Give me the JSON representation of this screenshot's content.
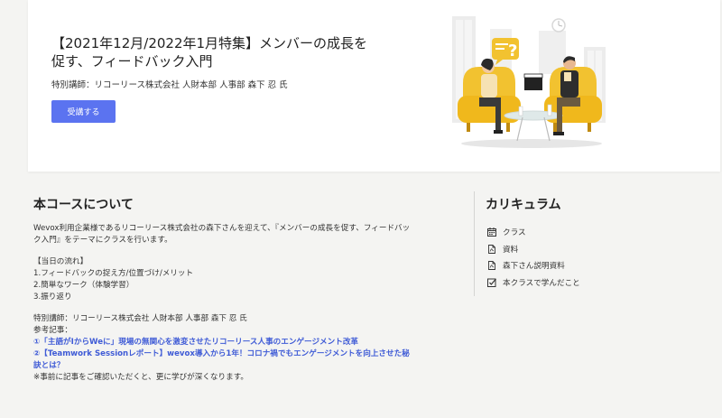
{
  "hero": {
    "title": "【2021年12月/2022年1月特集】メンバーの成長を促す、フィードバック入門",
    "instructor": "特別講師：リコーリース株式会社 人財本部 人事部 森下 忍 氏",
    "enroll_label": "受講する",
    "illustration_question_mark": "?"
  },
  "about": {
    "heading": "本コースについて",
    "intro": "Wevox利用企業様であるリコーリース株式会社の森下さんを迎えて、『メンバーの成長を促す、フィードバック入門』をテーマにクラスを行います。",
    "flow_heading": "【当日の流れ】",
    "flow_items": [
      "1.フィードバックの捉え方/位置づけ/メリット",
      "2.簡単なワーク（体験学習）",
      "3.振り返り"
    ],
    "instructor": "特別講師：リコーリース株式会社 人財本部 人事部 森下 忍 氏",
    "refs_heading": "参考記事：",
    "ref_links": [
      "①「主語がIからWeに」現場の無関心を激変させたリコーリース人事のエンゲージメント改革",
      "②【Teamwork Sessionレポート】wevox導入から1年！コロナ禍でもエンゲージメントを向上させた秘訣とは？"
    ],
    "note": "※事前に記事をご確認いただくと、更に学びが深くなります。"
  },
  "curriculum": {
    "heading": "カリキュラム",
    "items": [
      {
        "label": "クラス",
        "icon": "calendar-icon"
      },
      {
        "label": "資料",
        "icon": "pdf-file-icon"
      },
      {
        "label": "森下さん説明資料",
        "icon": "pdf-file-icon"
      },
      {
        "label": "本クラスで学んだこと",
        "icon": "checkbox-icon"
      }
    ]
  },
  "colors": {
    "accent": "#5b73f0",
    "link": "#3f5bd6",
    "background": "#f4f4f2",
    "chair": "#f2c230"
  }
}
